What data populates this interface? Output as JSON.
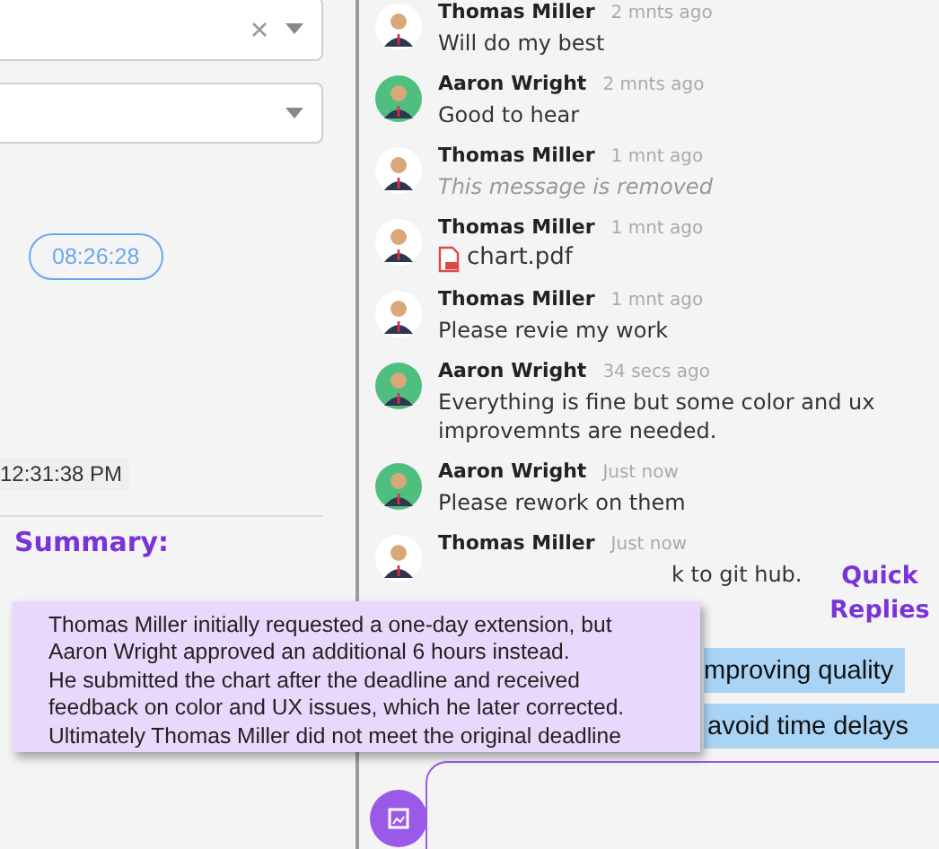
{
  "filters": [
    {
      "clearable": true
    },
    {
      "clearable": false
    }
  ],
  "timer": "08:26:28",
  "timestamp": "12:31:38 PM",
  "summary": {
    "heading": "Summary:",
    "text": "Thomas Miller initially requested a one-day extension, but\nAaron Wright approved an additional 6 hours instead.\nHe submitted the chart after the deadline and received\nfeedback on color and UX issues, which he later corrected.\nUltimately Thomas Miller did not meet the original deadline"
  },
  "messages": [
    {
      "name": "Thomas Miller",
      "time": "2 mnts ago",
      "kind": "text",
      "text": "Will do my best",
      "color": "#ffffff"
    },
    {
      "name": "Aaron Wright",
      "time": "2 mnts ago",
      "kind": "text",
      "text": "Good to hear",
      "color": "#4fbf7f"
    },
    {
      "name": "Thomas Miller",
      "time": "1 mnt ago",
      "kind": "removed",
      "text": "This message is removed",
      "color": "#ffffff"
    },
    {
      "name": "Thomas Miller",
      "time": "1 mnt ago",
      "kind": "file",
      "text": "chart.pdf",
      "color": "#ffffff"
    },
    {
      "name": "Thomas Miller",
      "time": "1 mnt ago",
      "kind": "text",
      "text": "Please revie my work",
      "color": "#ffffff"
    },
    {
      "name": "Aaron Wright",
      "time": "34 secs ago",
      "kind": "text",
      "text": "Everything is fine but some color and ux improvemnts are needed.",
      "color": "#4fbf7f"
    },
    {
      "name": "Aaron Wright",
      "time": "Just now",
      "kind": "text",
      "text": "Please rework on them",
      "color": "#4fbf7f"
    },
    {
      "name": "Thomas Miller",
      "time": "Just now",
      "kind": "text",
      "text": "k to git hub.",
      "color": "#ffffff"
    }
  ],
  "quick_replies": {
    "heading": "Quick\nReplies",
    "items": [
      "mproving quality",
      "avoid time delays"
    ]
  }
}
